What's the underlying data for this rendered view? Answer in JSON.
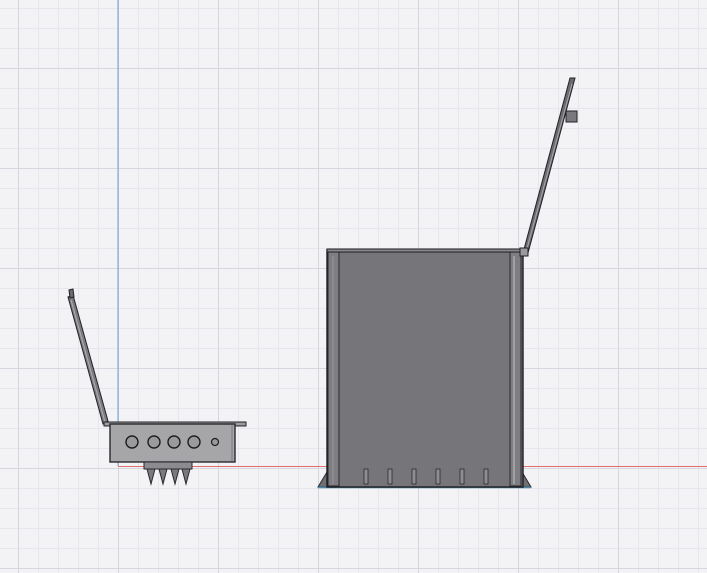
{
  "viewport": {
    "grid_visible": true,
    "background": "#f3f3f6",
    "grid_minor_color": "#e6e6ec",
    "grid_major_color": "#d6d6de"
  },
  "axes": {
    "vertical_axis_color": "#6a9fd8",
    "horizontal_axis_color": "#e07070"
  },
  "models": [
    {
      "name": "small-enclosure",
      "parts": [
        "enclosure-body",
        "open-lid",
        "connector-ports",
        "mounting-spikes"
      ]
    },
    {
      "name": "tall-enclosure",
      "parts": [
        "enclosure-body",
        "open-lid",
        "base-flange"
      ]
    }
  ],
  "material_colors": {
    "metal_dark": "#727276",
    "metal_light": "#a6a6a9",
    "outline": "#2a2a2e"
  }
}
